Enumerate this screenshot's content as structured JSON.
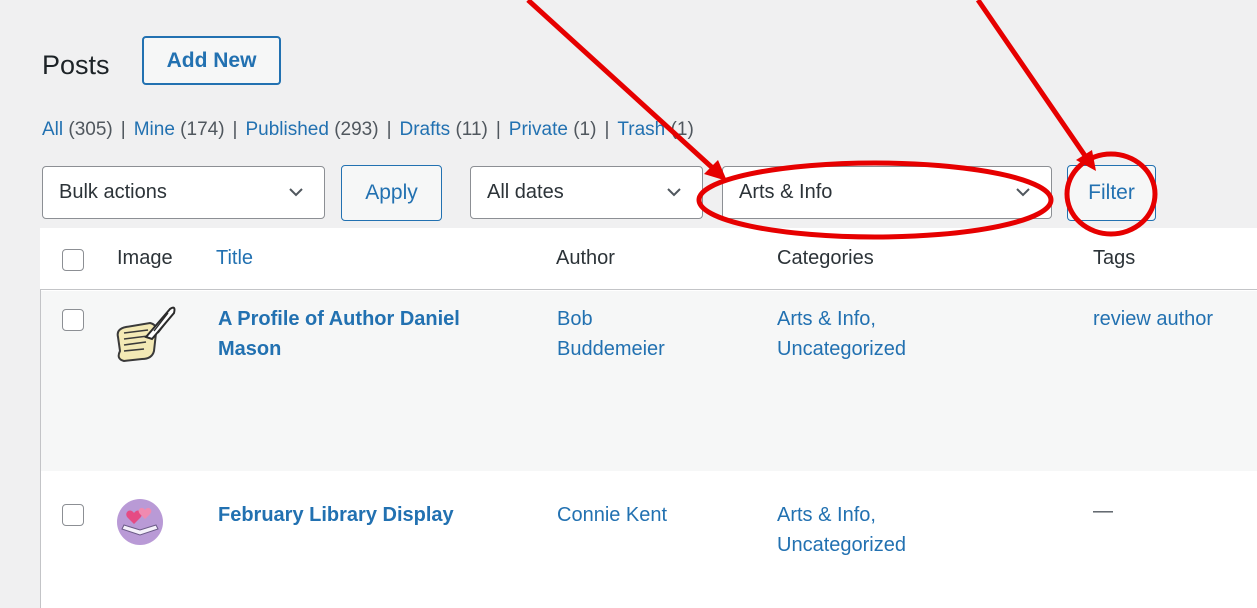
{
  "header": {
    "title": "Posts",
    "add_new": "Add New"
  },
  "views": [
    {
      "label": "All",
      "count": "(305)"
    },
    {
      "label": "Mine",
      "count": "(174)"
    },
    {
      "label": "Published",
      "count": "(293)"
    },
    {
      "label": "Drafts",
      "count": "(11)"
    },
    {
      "label": "Private",
      "count": "(1)"
    },
    {
      "label": "Trash",
      "count": "(1)"
    }
  ],
  "separator": "|",
  "toolbar": {
    "bulk_actions": "Bulk actions",
    "apply": "Apply",
    "dates": "All dates",
    "category": "Arts & Info",
    "filter": "Filter"
  },
  "columns": {
    "image": "Image",
    "title": "Title",
    "author": "Author",
    "categories": "Categories",
    "tags": "Tags"
  },
  "rows": [
    {
      "title_line1": "A Profile of Author Daniel",
      "title_line2": "Mason",
      "author_line1": "Bob",
      "author_line2": "Buddemeier",
      "cat_line1": "Arts & Info,",
      "cat_line2": "Uncategorized",
      "tags": "review author",
      "thumb_icon": "quill-scroll-icon"
    },
    {
      "title_line1": "February Library Display",
      "author_line1": "Connie Kent",
      "cat_line1": "Arts & Info,",
      "cat_line2": "Uncategorized",
      "tags": "—",
      "thumb_icon": "hearts-book-icon"
    }
  ],
  "colors": {
    "link": "#2271b1",
    "annotation": "#e60000"
  }
}
